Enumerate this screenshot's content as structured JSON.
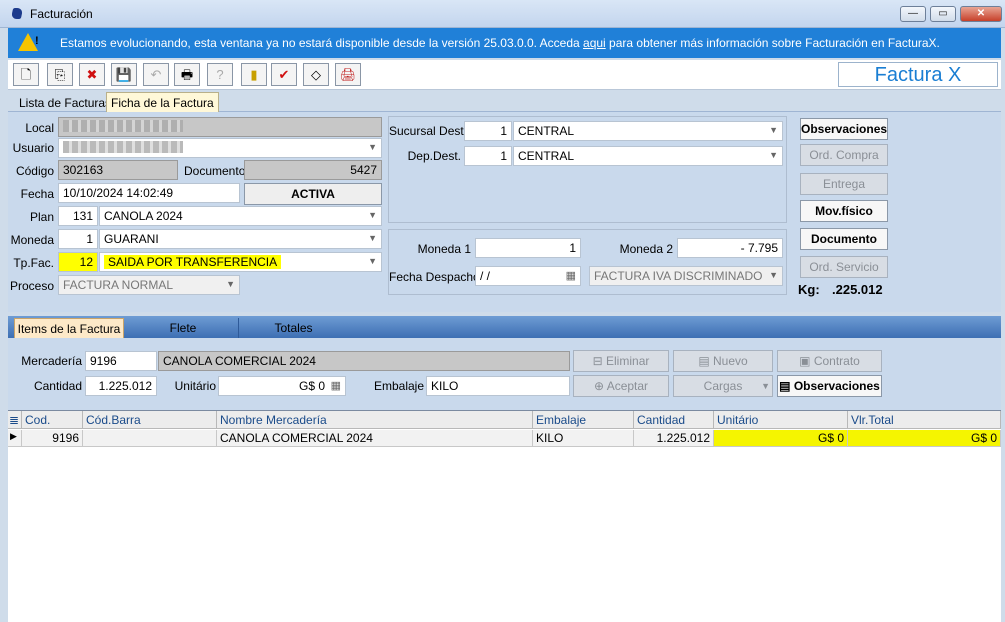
{
  "window": {
    "title": "Facturación",
    "min": "—",
    "max": "▭",
    "close": "✕"
  },
  "banner": {
    "text_before": "Estamos evolucionando, esta ventana ya no estará disponible desde la versión 25.03.0.0. Acceda ",
    "link": "aqui",
    "text_after": " para obtener más información sobre Facturación en FacturaX.",
    "icon": "!"
  },
  "toolbar": {
    "icons": [
      "new-doc-icon",
      "duplicate-icon",
      "delete-doc-icon",
      "save-icon",
      "undo-icon",
      "print-icon",
      "help-icon",
      "exit-icon",
      "confirm-icon",
      "eraser-icon",
      "print-fiscal-icon"
    ],
    "glyphs": [
      "🗋",
      "⎘",
      "✖",
      "💾",
      "↶",
      "🖶",
      "?",
      "▮",
      "✔",
      "◇",
      "🖨"
    ],
    "brand": "Factura X"
  },
  "tabs": [
    "Lista de Facturas",
    "Ficha de la Factura"
  ],
  "form": {
    "local_label": "Local",
    "usuario_label": "Usuario",
    "codigo_label": "Código",
    "codigo": "302163",
    "documento_label": "Documento",
    "documento": "5427",
    "fecha_label": "Fecha",
    "fecha": "10/10/2024 14:02:49",
    "estado": "ACTIVA",
    "plan_label": "Plan",
    "plan_code": "131",
    "plan": "CANOLA 2024",
    "moneda_label": "Moneda",
    "moneda_code": "1",
    "moneda": "GUARANI",
    "tpfac_label": "Tp.Fac.",
    "tpfac_code": "12",
    "tpfac": "SAIDA POR TRANSFERENCIA",
    "proceso_label": "Proceso",
    "proceso": "FACTURA NORMAL",
    "sucursal_label": "Sucursal Dest.",
    "sucursal_code": "1",
    "sucursal": "CENTRAL",
    "dep_label": "Dep.Dest.",
    "dep_code": "1",
    "dep": "CENTRAL",
    "moneda1_label": "Moneda 1",
    "moneda1": "1",
    "moneda2_label": "Moneda 2",
    "moneda2": "- 7.795",
    "fecha_despacho_label": "Fecha Despacho",
    "fecha_despacho": " /  /",
    "tipo_iva": "FACTURA IVA DISCRIMINADO",
    "kg_label": "Kg:",
    "kg": ".225.012"
  },
  "side_buttons": [
    "Observaciones",
    "Ord. Compra",
    "Entrega",
    "Mov.físico",
    "Documento",
    "Ord. Servicio"
  ],
  "item_tabs": [
    "Items de la Factura",
    "Flete",
    "Totales"
  ],
  "item_form": {
    "mercaderia_label": "Mercadería",
    "mercaderia_code": "9196",
    "mercaderia": "CANOLA COMERCIAL 2024",
    "cantidad_label": "Cantidad",
    "cantidad": "1.225.012",
    "unitario_label": "Unitário",
    "unitario": "G$ 0",
    "embalaje_label": "Embalaje",
    "embalaje": "KILO"
  },
  "item_buttons": {
    "eliminar": "Eliminar",
    "nuevo": "Nuevo",
    "contrato": "Contrato",
    "aceptar": "Aceptar",
    "cargas": "Cargas",
    "observaciones": "Observaciones"
  },
  "grid": {
    "headers": [
      "Cod.",
      "Cód.Barra",
      "Nombre Mercadería",
      "Embalaje",
      "Cantidad",
      "Unitário",
      "Vlr.Total"
    ],
    "rows": [
      [
        "9196",
        "",
        "CANOLA COMERCIAL 2024",
        "KILO",
        "1.225.012",
        "G$ 0",
        "G$ 0"
      ]
    ]
  },
  "colors": {
    "banner": "#2080d8",
    "highlight": "#ffff00",
    "brand": "#1a7ed3"
  }
}
